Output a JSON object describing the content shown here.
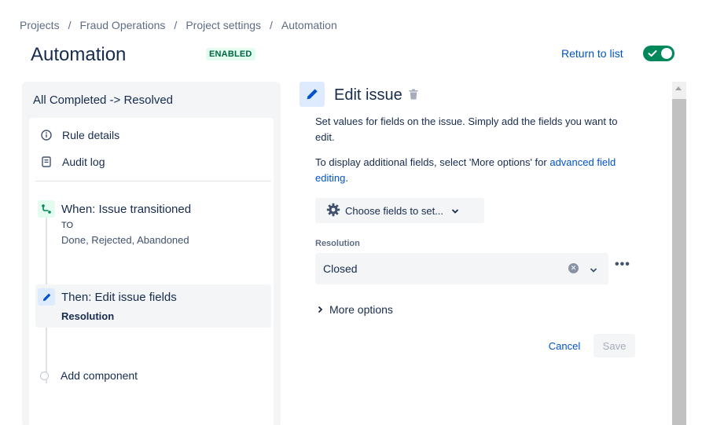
{
  "breadcrumb": [
    "Projects",
    "Fraud Operations",
    "Project settings",
    "Automation"
  ],
  "breadcrumb_separator": "/",
  "page": {
    "title": "Automation",
    "status": "ENABLED",
    "return_link": "Return to list",
    "toggle_on": true
  },
  "rule": {
    "name": "All Completed -> Resolved",
    "menu": {
      "details": "Rule details",
      "audit": "Audit log"
    },
    "trigger": {
      "title": "When: Issue transitioned",
      "to_label": "TO",
      "values": "Done, Rejected, Abandoned"
    },
    "action": {
      "title": "Then: Edit issue fields",
      "field": "Resolution"
    },
    "add_component": "Add component"
  },
  "editor": {
    "title": "Edit issue",
    "description1": "Set values for fields on the issue. Simply add the fields you want to edit.",
    "description2_prefix": "To display additional fields, select 'More options' for ",
    "description2_link": "advanced field editing",
    "description2_suffix": ".",
    "choose_fields": "Choose fields to set...",
    "field_label": "Resolution",
    "field_value": "Closed",
    "more_options": "More options",
    "cancel": "Cancel",
    "save": "Save"
  },
  "colors": {
    "accent": "#0052cc",
    "toggle": "#00875a",
    "lozenge_bg": "#e3fcef",
    "lozenge_text": "#006644"
  }
}
